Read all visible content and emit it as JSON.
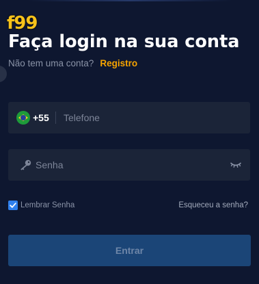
{
  "brand": {
    "logo_text": "f99",
    "logo_color": "#f6c21a"
  },
  "header": {
    "title": "Faça login na sua conta",
    "subtitle": "Não tem uma conta?",
    "register_link": "Registro",
    "register_color": "#f7a400"
  },
  "phone": {
    "flag_icon": "brazil-flag-icon",
    "dial_code": "+55",
    "placeholder": "Telefone",
    "value": ""
  },
  "password": {
    "icon": "key-icon",
    "placeholder": "Senha",
    "value": "",
    "toggle_icon": "eye-closed-icon"
  },
  "remember": {
    "label": "Lembrar Senha",
    "checked": true,
    "checkbox_color": "#2f80ed"
  },
  "forgot_link": "Esqueceu a senha?",
  "submit": {
    "label": "Entrar",
    "background": "#1b4577"
  },
  "colors": {
    "background": "#0e1730",
    "field_background": "#1b2438"
  }
}
